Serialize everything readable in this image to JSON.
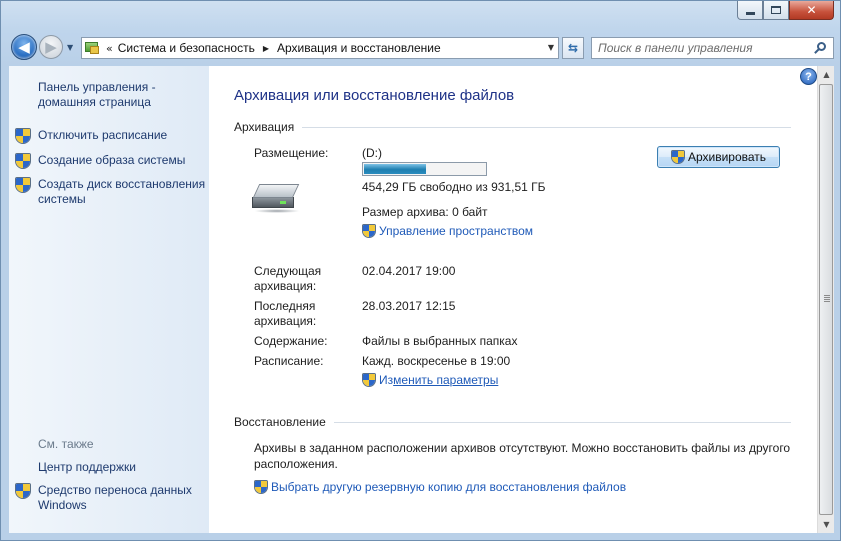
{
  "window": {
    "caption_close": "✕"
  },
  "nav": {
    "back_glyph": "◀",
    "forward_glyph": "▶",
    "address": {
      "chevron": "«",
      "segments": [
        "Система и безопасность",
        "Архивация и восстановление"
      ]
    },
    "search_placeholder": "Поиск в панели управления"
  },
  "sidebar": {
    "home_link": "Панель управления - домашняя страница",
    "tasks": [
      {
        "label": "Отключить расписание",
        "icon": "uac-shield-icon"
      },
      {
        "label": "Создание образа системы",
        "icon": "uac-shield-icon"
      },
      {
        "label": "Создать диск восстановления системы",
        "icon": "uac-shield-icon"
      }
    ],
    "see_also_title": "См. также",
    "see_also": [
      {
        "label": "Центр поддержки"
      },
      {
        "label": "Средство переноса данных Windows",
        "icon": "uac-shield-icon"
      }
    ]
  },
  "main": {
    "help": "?",
    "title": "Архивация или восстановление файлов",
    "backup": {
      "section_title": "Архивация",
      "location_label": "Размещение:",
      "drive_name": "(D:)",
      "drive_used_fraction": 0.51,
      "free_space": "454,29 ГБ свободно из 931,51 ГБ",
      "backup_size": "Размер архива: 0 байт",
      "manage_space_link": "Управление пространством",
      "backup_button": "Архивировать",
      "next_label": "Следующая архивация:",
      "next_value": "02.04.2017 19:00",
      "last_label": "Последняя архивация:",
      "last_value": "28.03.2017 12:15",
      "contents_label": "Содержание:",
      "contents_value": "Файлы в выбранных папках",
      "schedule_label": "Расписание:",
      "schedule_value": "Кажд. воскресенье в 19:00",
      "change_settings_prefix": "Из",
      "change_settings_underlined": "менить параметры"
    },
    "restore": {
      "section_title": "Восстановление",
      "message": "Архивы в заданном расположении архивов отсутствуют. Можно восстановить файлы из другого расположения.",
      "select_backup_link": "Выбрать другую резервную копию для восстановления файлов"
    }
  },
  "colors": {
    "link": "#1f5ab8",
    "title": "#1e3287",
    "progress": "#1f7fb0"
  }
}
